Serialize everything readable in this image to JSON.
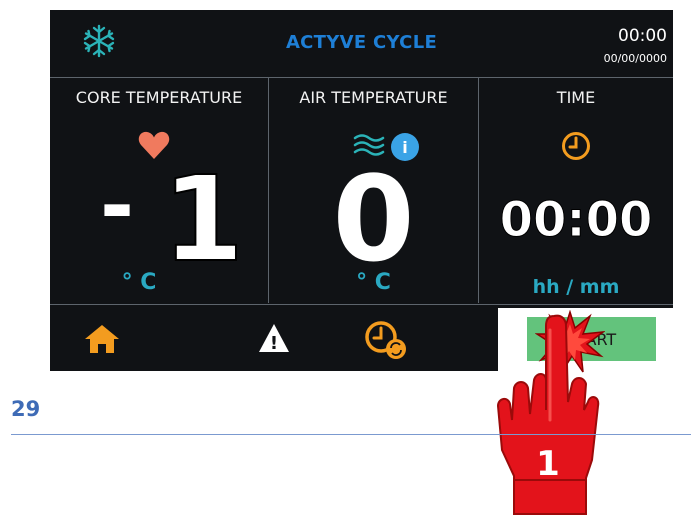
{
  "header": {
    "icon": "snowflake-icon",
    "title": "ACTYVE CYCLE",
    "clock": "00:00",
    "date": "00/00/0000"
  },
  "core": {
    "label": "CORE TEMPERATURE",
    "icon": "heart-icon",
    "value": "-1",
    "sign": "-",
    "digit": "1",
    "unit": "° C"
  },
  "air": {
    "label": "AIR TEMPERATURE",
    "icons": [
      "air-waves-icon",
      "info-icon"
    ],
    "info_letter": "i",
    "value": "0",
    "unit": "° C"
  },
  "time": {
    "label": "TIME",
    "icon": "clock-icon",
    "value": "00:00",
    "unit": "hh / mm"
  },
  "bottom_bar": {
    "icons": [
      "home-icon",
      "warning-icon",
      "timer-cycle-icon"
    ],
    "warning_glyph": "!",
    "start_label": "START"
  },
  "annotation": {
    "step_number": "1"
  },
  "page_number": "29",
  "colors": {
    "background": "#101215",
    "title_blue": "#1e7fd6",
    "unit_teal": "#2aa9c2",
    "accent_orange": "#f39c1f",
    "heart": "#f07a5e",
    "start_green": "#63c37c",
    "hand_red": "#e3131b"
  }
}
